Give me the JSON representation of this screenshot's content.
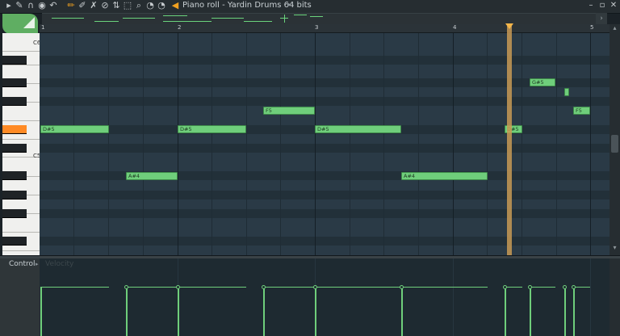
{
  "window": {
    "title": "Piano roll - Yardin Drums 64 bits",
    "title_arrow": "▸",
    "minimize": "–",
    "restore": "▫",
    "close": "✕"
  },
  "toolbar": {
    "icons": [
      {
        "name": "arrow-menu-icon",
        "glyph": "▸"
      },
      {
        "name": "wrench-icon",
        "glyph": "✎"
      },
      {
        "name": "magnet-icon",
        "glyph": "∩"
      },
      {
        "name": "record-icon",
        "glyph": "◉"
      },
      {
        "name": "undo-icon",
        "glyph": "↶"
      },
      {
        "name": "pencil-icon",
        "glyph": "✏"
      },
      {
        "name": "paint-brush-icon",
        "glyph": "✐"
      },
      {
        "name": "delete-icon",
        "glyph": "✗"
      },
      {
        "name": "mute-icon",
        "glyph": "⊘"
      },
      {
        "name": "slice-icon",
        "glyph": "⇅"
      },
      {
        "name": "select-icon",
        "glyph": "⬚"
      },
      {
        "name": "zoom-icon",
        "glyph": "⌕"
      },
      {
        "name": "playback-icon",
        "glyph": "◔"
      },
      {
        "name": "speaker-icon",
        "glyph": "◀"
      }
    ]
  },
  "overview": {
    "left_arrow": "‹",
    "right_arrow": "›"
  },
  "ruler": {
    "bars": [
      "1",
      "2",
      "3",
      "4",
      "5"
    ]
  },
  "keyboard": {
    "labels": {
      "c6": "C6",
      "c5": "C5"
    }
  },
  "notes": [
    {
      "label": "D#5"
    },
    {
      "label": "A#4"
    },
    {
      "label": "D#5"
    },
    {
      "label": "F5"
    },
    {
      "label": "D#5"
    },
    {
      "label": "A#4"
    },
    {
      "label": "D#5"
    },
    {
      "label": "G#5"
    },
    {
      "label": ""
    },
    {
      "label": "F5"
    }
  ],
  "control": {
    "label": "Control",
    "arrow": "▸",
    "parameter": "Velocity"
  },
  "colors": {
    "note": "#6fce7b",
    "playhead": "#f5b74a",
    "active_key": "#ff8a24",
    "corner_tool": "#5fae62"
  }
}
